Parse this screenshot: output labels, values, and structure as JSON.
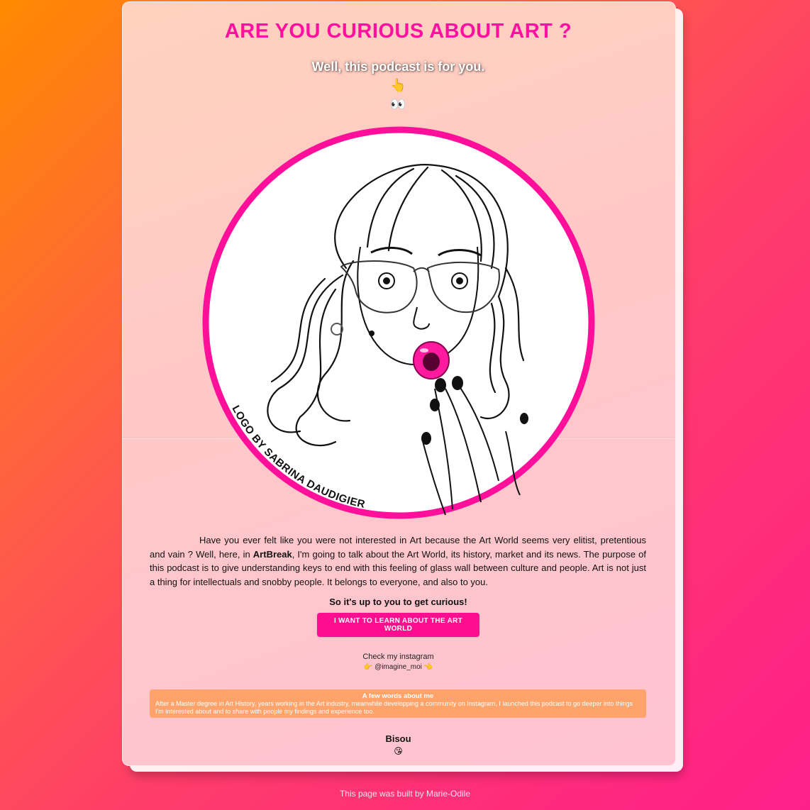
{
  "header": {
    "title": "ARE YOU CURIOUS ABOUT ART ?",
    "subtitle": "Well, this podcast is for you.",
    "emoji_pointing": "👆",
    "emoji_eyes": "👀"
  },
  "logo": {
    "credit": "LOGO BY SABRINA DAUDIGIER",
    "ring_color": "#ff0f9a",
    "lip_color": "#ff1aa0"
  },
  "intro": {
    "part1": "Have you ever felt like you were not interested in Art because the Art World seems very elitist, pretentious and vain ? Well, here, in ",
    "brand": "ArtBreak",
    "part2": ", I'm going to talk about the Art World, its history, market and its news. The purpose of this podcast is to give understanding keys to end with this feeling of glass wall between culture and people. Art is not just a thing for intellectuals and snobby people. It belongs to everyone, and also to you."
  },
  "cta": {
    "tagline": "So it's up to you to get curious!",
    "button_label": "I WANT TO LEARN ABOUT THE ART WORLD"
  },
  "instagram": {
    "label": "Check my instagram",
    "emoji_left": "👉",
    "handle": "@imagine_moi",
    "emoji_right": "👈"
  },
  "about": {
    "title": "A few words about me",
    "text": "After a Master degree in Art History, years working in the Art industry, meanwhile developping a community on Instagram, I launched this podcast to go deeper into things I'm interested about and to share with people my findings and experience too."
  },
  "signoff": {
    "text": "Bisou",
    "emoji": "😘"
  },
  "footer": {
    "text": "This page was built by Marie-Odile"
  },
  "colors": {
    "accent": "#ff10a0",
    "about_bg": "#ffa36a",
    "button_bg": "#ff0f8f"
  }
}
